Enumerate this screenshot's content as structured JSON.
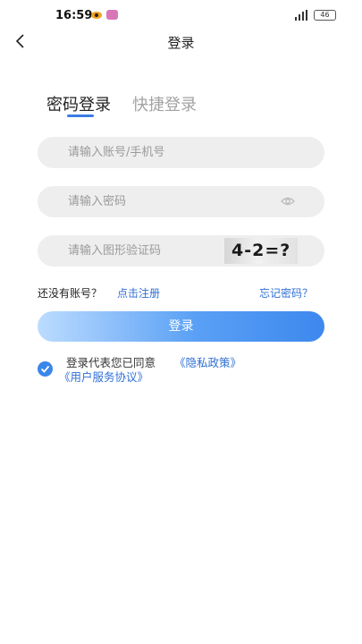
{
  "status_bar": {
    "time": "16:59",
    "battery": "46"
  },
  "nav": {
    "title": "登录"
  },
  "tabs": {
    "password_login": "密码登录",
    "quick_login": "快捷登录"
  },
  "form": {
    "account_placeholder": "请输入账号/手机号",
    "password_placeholder": "请输入密码",
    "captcha_placeholder": "请输入图形验证码",
    "captcha_text": "4-2=?"
  },
  "links": {
    "no_account": "还没有账号？",
    "register": "点击注册",
    "forgot_password": "忘记密码？"
  },
  "login_button": "登录",
  "agreement": {
    "checked": true,
    "text": "登录代表您已同意",
    "privacy": "《隐私政策》",
    "service": "《用户服务协议》"
  },
  "colors": {
    "accent": "#3a7ce6",
    "link": "#2f6fd6",
    "input_bg": "#eeeeee"
  }
}
